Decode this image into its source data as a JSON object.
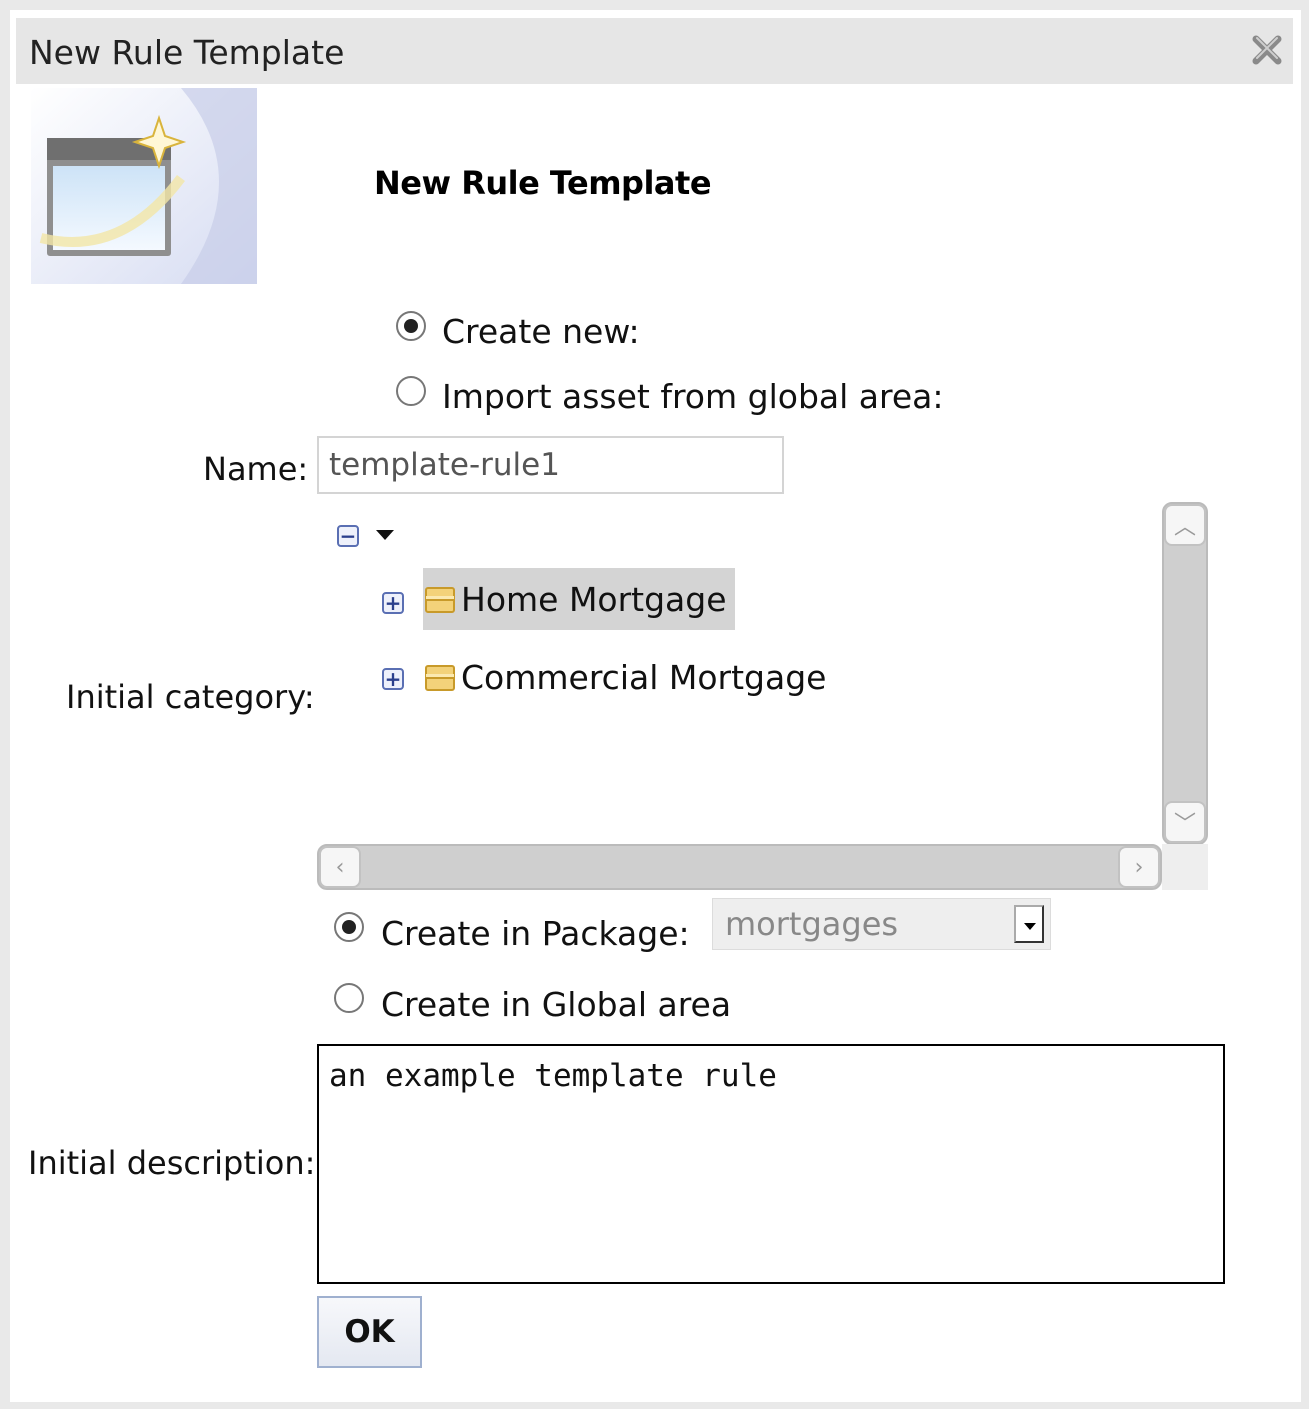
{
  "dialog": {
    "title": "New Rule Template",
    "heading": "New Rule Template"
  },
  "mode": {
    "create_new_label": "Create new:",
    "import_label": "Import asset from global area:",
    "selected": "create_new"
  },
  "form": {
    "name_label": "Name:",
    "name_value": "template-rule1",
    "category_label": "Initial category:",
    "description_label": "Initial description:",
    "description_value": "an example template rule"
  },
  "category_tree": {
    "items": [
      {
        "label": "Home Mortgage",
        "selected": true
      },
      {
        "label": "Commercial Mortgage",
        "selected": false
      }
    ]
  },
  "location": {
    "package_label": "Create in Package:",
    "package_value": "mortgages",
    "global_label": "Create in Global area",
    "selected": "package"
  },
  "actions": {
    "ok_label": "OK"
  },
  "icons": {
    "close": "close-icon",
    "wizard": "new-item-wizard-icon",
    "collapse": "tree-collapse-icon",
    "expand": "tree-expand-icon",
    "folder": "category-folder-icon"
  },
  "colors": {
    "titlebar": "#e6e6e6",
    "selection": "#d4d4d4",
    "folder": "#e8b84a"
  }
}
